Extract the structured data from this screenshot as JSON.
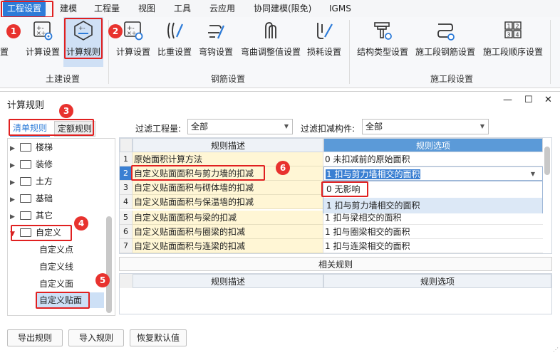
{
  "menubar": {
    "items": [
      "工程设置",
      "建模",
      "工程量",
      "视图",
      "工具",
      "云应用",
      "协同建模(限免)",
      "IGMS"
    ]
  },
  "ribbon": {
    "tools": {
      "left_cut": "置",
      "calc_settings_civil": "计算设置",
      "calc_rules_civil": "计算规则",
      "calc_settings_rebar": "计算设置",
      "density_settings": "比重设置",
      "hook_settings": "弯钩设置",
      "bend_adjust_settings": "弯曲调整值设置",
      "loss_settings": "损耗设置",
      "structure_type_settings": "结构类型设置",
      "segment_rebar_settings": "施工段钢筋设置",
      "segment_order_settings": "施工段顺序设置"
    },
    "groups": {
      "civil": "土建设置",
      "rebar": "钢筋设置",
      "segment": "施工段设置"
    }
  },
  "badges": [
    "1",
    "2",
    "3",
    "4",
    "5",
    "6"
  ],
  "dialog": {
    "title": "计算规则",
    "tabs": [
      "清单规则",
      "定额规则"
    ],
    "filter_quantity_label": "过滤工程量:",
    "filter_quantity_value": "全部",
    "filter_component_label": "过滤扣减构件:",
    "filter_component_value": "全部",
    "tree": {
      "folders": [
        "楼梯",
        "装修",
        "土方",
        "基础",
        "其它",
        "自定义"
      ],
      "children": [
        "自定义点",
        "自定义线",
        "自定义面",
        "自定义贴面"
      ]
    },
    "grid": {
      "headers": [
        "规则描述",
        "规则选项"
      ],
      "rows": [
        {
          "num": "1",
          "desc": "原始面积计算方法",
          "opt": "0 未扣减前的原始面积"
        },
        {
          "num": "2",
          "desc": "自定义贴面面积与剪力墙的扣减",
          "opt": "1 扣与剪力墙相交的面积"
        },
        {
          "num": "3",
          "desc": "自定义贴面面积与砌体墙的扣减",
          "opt": ""
        },
        {
          "num": "4",
          "desc": "自定义贴面面积与保温墙的扣减",
          "opt": ""
        },
        {
          "num": "5",
          "desc": "自定义贴面面积与梁的扣减",
          "opt": "1 扣与梁相交的面积"
        },
        {
          "num": "6",
          "desc": "自定义贴面面积与圈梁的扣减",
          "opt": "1 扣与圈梁相交的面积"
        },
        {
          "num": "7",
          "desc": "自定义贴面面积与连梁的扣减",
          "opt": "1 扣与连梁相交的面积"
        }
      ],
      "dropdown_options": [
        "0  无影响",
        "1 扣与剪力墙相交的面积"
      ]
    },
    "related_rules_label": "相关规则",
    "related_headers": [
      "规则描述",
      "规则选项"
    ],
    "buttons": {
      "export": "导出规则",
      "import": "导入规则",
      "restore": "恢复默认值"
    },
    "window_controls": {
      "minimize": "—",
      "maximize": "☐",
      "close": "✕"
    }
  },
  "colors": {
    "accent": "#2d7bd8",
    "highlight": "#e02020",
    "row_yellow": "#fff6d5",
    "header_blue": "#5b9ad8"
  }
}
